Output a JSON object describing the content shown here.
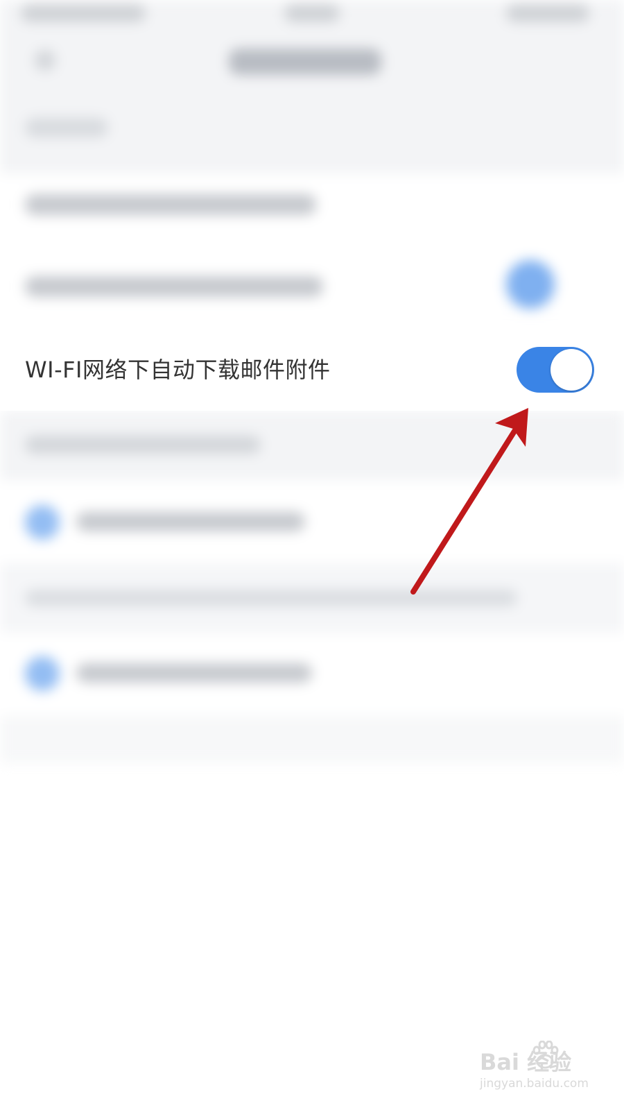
{
  "settings": {
    "wifi_auto_download": {
      "label": "WI-FI网络下自动下载邮件附件",
      "enabled": true
    }
  },
  "colors": {
    "toggle_on": "#3a84e6",
    "arrow": "#c0191b",
    "label_text": "#333333"
  },
  "watermark": {
    "brand": "Bai  经验",
    "url": "jingyan.baidu.com"
  }
}
